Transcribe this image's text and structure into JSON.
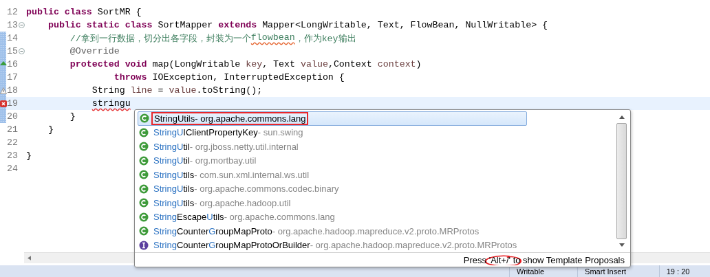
{
  "editor": {
    "lines": [
      {
        "number": "12",
        "kind": "plain",
        "changed": false,
        "current": false,
        "foldable": false,
        "tokens": [
          {
            "text": "public class ",
            "kind": "keyword"
          },
          {
            "text": "SortMR {",
            "kind": "plain"
          }
        ]
      },
      {
        "number": "13",
        "kind": "plain",
        "changed": false,
        "current": false,
        "foldable": true,
        "tokens": [
          {
            "text": "    public static class ",
            "kind": "keyword"
          },
          {
            "text": "SortMapper ",
            "kind": "plain"
          },
          {
            "text": "extends ",
            "kind": "keyword"
          },
          {
            "text": "Mapper<LongWritable, Text, FlowBean, NullWritable> {",
            "kind": "plain"
          }
        ]
      },
      {
        "number": "14",
        "kind": "plain",
        "changed": true,
        "current": false,
        "foldable": false,
        "tokens": [
          {
            "text": "        //拿到一行数据，切分出各字段，封装为一个",
            "kind": "comment"
          },
          {
            "text": "flowbean",
            "kind": "comment-misspelled"
          },
          {
            "text": "，作为key输出",
            "kind": "comment"
          }
        ]
      },
      {
        "number": "15",
        "kind": "plain",
        "changed": true,
        "current": false,
        "foldable": true,
        "tokens": [
          {
            "text": "        @Override",
            "kind": "annotation"
          }
        ]
      },
      {
        "number": "16",
        "kind": "override",
        "changed": true,
        "current": false,
        "foldable": false,
        "tokens": [
          {
            "text": "        protected void ",
            "kind": "keyword"
          },
          {
            "text": "map(LongWritable ",
            "kind": "plain"
          },
          {
            "text": "key",
            "kind": "local"
          },
          {
            "text": ", Text ",
            "kind": "plain"
          },
          {
            "text": "value",
            "kind": "local"
          },
          {
            "text": ",Context ",
            "kind": "plain"
          },
          {
            "text": "context",
            "kind": "local"
          },
          {
            "text": ")",
            "kind": "plain"
          }
        ]
      },
      {
        "number": "17",
        "kind": "plain",
        "changed": true,
        "current": false,
        "foldable": false,
        "tokens": [
          {
            "text": "                throws ",
            "kind": "keyword"
          },
          {
            "text": "IOException, InterruptedException {",
            "kind": "plain"
          }
        ]
      },
      {
        "number": "18",
        "kind": "warning",
        "changed": true,
        "current": false,
        "foldable": false,
        "tokens": [
          {
            "text": "            String ",
            "kind": "plain"
          },
          {
            "text": "line",
            "kind": "local"
          },
          {
            "text": " = ",
            "kind": "plain"
          },
          {
            "text": "value",
            "kind": "local"
          },
          {
            "text": ".toString();",
            "kind": "plain"
          }
        ]
      },
      {
        "number": "19",
        "kind": "error",
        "changed": true,
        "current": true,
        "foldable": false,
        "tokens": [
          {
            "text": "            stringu",
            "kind": "error"
          }
        ]
      },
      {
        "number": "20",
        "kind": "plain",
        "changed": true,
        "current": false,
        "foldable": false,
        "tokens": [
          {
            "text": "        }",
            "kind": "plain"
          }
        ]
      },
      {
        "number": "21",
        "kind": "plain",
        "changed": false,
        "current": false,
        "foldable": false,
        "tokens": [
          {
            "text": "    }",
            "kind": "plain"
          }
        ]
      },
      {
        "number": "22",
        "kind": "plain",
        "changed": false,
        "current": false,
        "foldable": false
      },
      {
        "number": "23",
        "kind": "plain",
        "changed": false,
        "current": false,
        "foldable": false,
        "tokens": [
          {
            "text": "}",
            "kind": "plain"
          }
        ]
      },
      {
        "number": "24",
        "kind": "plain",
        "changed": false,
        "current": false,
        "foldable": false
      }
    ]
  },
  "proposals": {
    "items": [
      {
        "kind": "class",
        "selected": true,
        "outlined": true,
        "name": [
          {
            "text": "StringUtils"
          }
        ],
        "package": "- org.apache.commons.lang"
      },
      {
        "kind": "class",
        "selected": false,
        "outlined": false,
        "name": [
          {
            "text": "StringU",
            "match": true
          },
          {
            "text": "IClientPropertyKey",
            "match": false
          }
        ],
        "package": "- sun.swing"
      },
      {
        "kind": "class",
        "selected": false,
        "outlined": false,
        "name": [
          {
            "text": "StringU",
            "match": true
          },
          {
            "text": "til",
            "match": false
          }
        ],
        "package": "- org.jboss.netty.util.internal"
      },
      {
        "kind": "class",
        "selected": false,
        "outlined": false,
        "name": [
          {
            "text": "StringU",
            "match": true
          },
          {
            "text": "til",
            "match": false
          }
        ],
        "package": "- org.mortbay.util"
      },
      {
        "kind": "class",
        "selected": false,
        "outlined": false,
        "name": [
          {
            "text": "StringU",
            "match": true
          },
          {
            "text": "tils",
            "match": false
          }
        ],
        "package": "- com.sun.xml.internal.ws.util"
      },
      {
        "kind": "class",
        "selected": false,
        "outlined": false,
        "name": [
          {
            "text": "StringU",
            "match": true
          },
          {
            "text": "tils",
            "match": false
          }
        ],
        "package": "- org.apache.commons.codec.binary"
      },
      {
        "kind": "class",
        "selected": false,
        "outlined": false,
        "name": [
          {
            "text": "StringU",
            "match": true
          },
          {
            "text": "tils",
            "match": false
          }
        ],
        "package": "- org.apache.hadoop.util"
      },
      {
        "kind": "class",
        "selected": false,
        "outlined": false,
        "name": [
          {
            "text": "String",
            "match": true
          },
          {
            "text": "Escape",
            "match": false
          },
          {
            "text": "U",
            "match": true
          },
          {
            "text": "tils",
            "match": false
          }
        ],
        "package": "- org.apache.commons.lang"
      },
      {
        "kind": "class",
        "selected": false,
        "outlined": false,
        "name": [
          {
            "text": "String",
            "match": true
          },
          {
            "text": "Counter",
            "match": false
          },
          {
            "text": "G",
            "match": true
          },
          {
            "text": "roupMapProto",
            "match": false
          }
        ],
        "package": "- org.apache.hadoop.mapreduce.v2.proto.MRProtos"
      },
      {
        "kind": "interface",
        "selected": false,
        "outlined": false,
        "name": [
          {
            "text": "String",
            "match": true
          },
          {
            "text": "Counter",
            "match": false
          },
          {
            "text": "G",
            "match": true
          },
          {
            "text": "roupMapProtoOrBuilder",
            "match": false
          }
        ],
        "package": "- org.apache.hadoop.mapreduce.v2.proto.MRProtos"
      }
    ],
    "footer": {
      "text": "Press 'Alt+/' to show Template Proposals",
      "circled": true
    }
  },
  "status_bar": [
    "Writable",
    "Smart Insert",
    "19 : 20"
  ]
}
